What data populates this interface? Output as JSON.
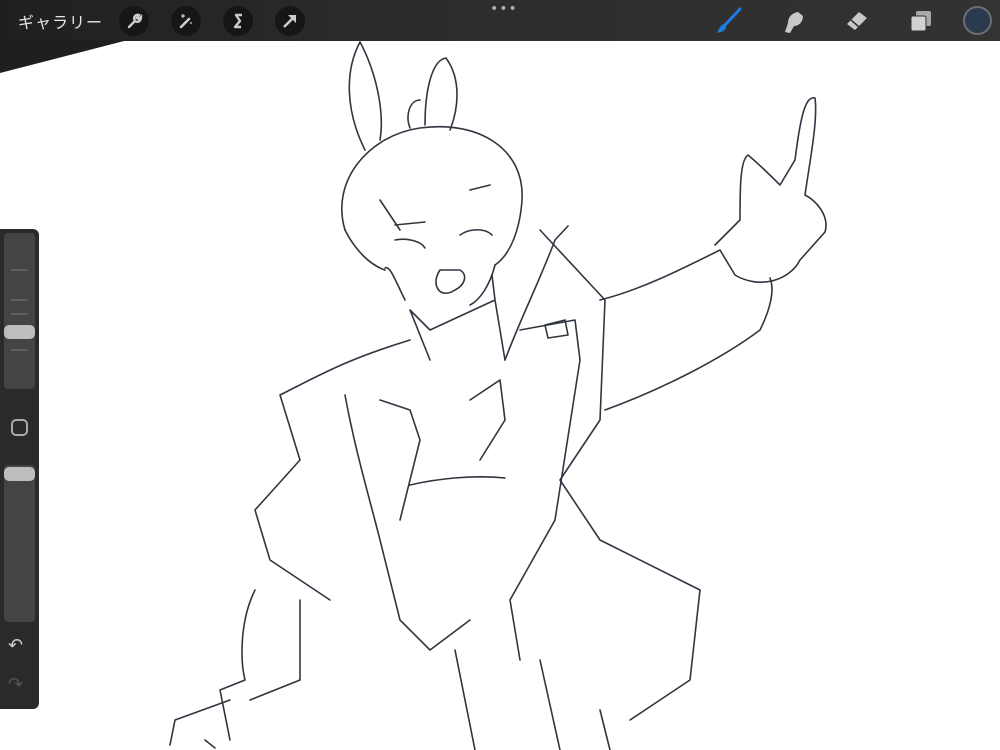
{
  "topbar": {
    "gallery_label": "ギャラリー",
    "left_tools": [
      "wrench-icon",
      "magic-wand-icon",
      "selection-icon",
      "transform-arrow-icon"
    ],
    "more_dots": "•••",
    "right_tools": [
      "brush-icon",
      "smudge-icon",
      "eraser-icon",
      "layers-icon"
    ],
    "active_tool": "brush",
    "accent_color": "#1e7be6",
    "current_color": "#2b3a4f"
  },
  "sidebar": {
    "brush_size_fraction": 0.37,
    "opacity_fraction": 0.95,
    "undo_symbol": "↶",
    "redo_symbol": "↷"
  }
}
